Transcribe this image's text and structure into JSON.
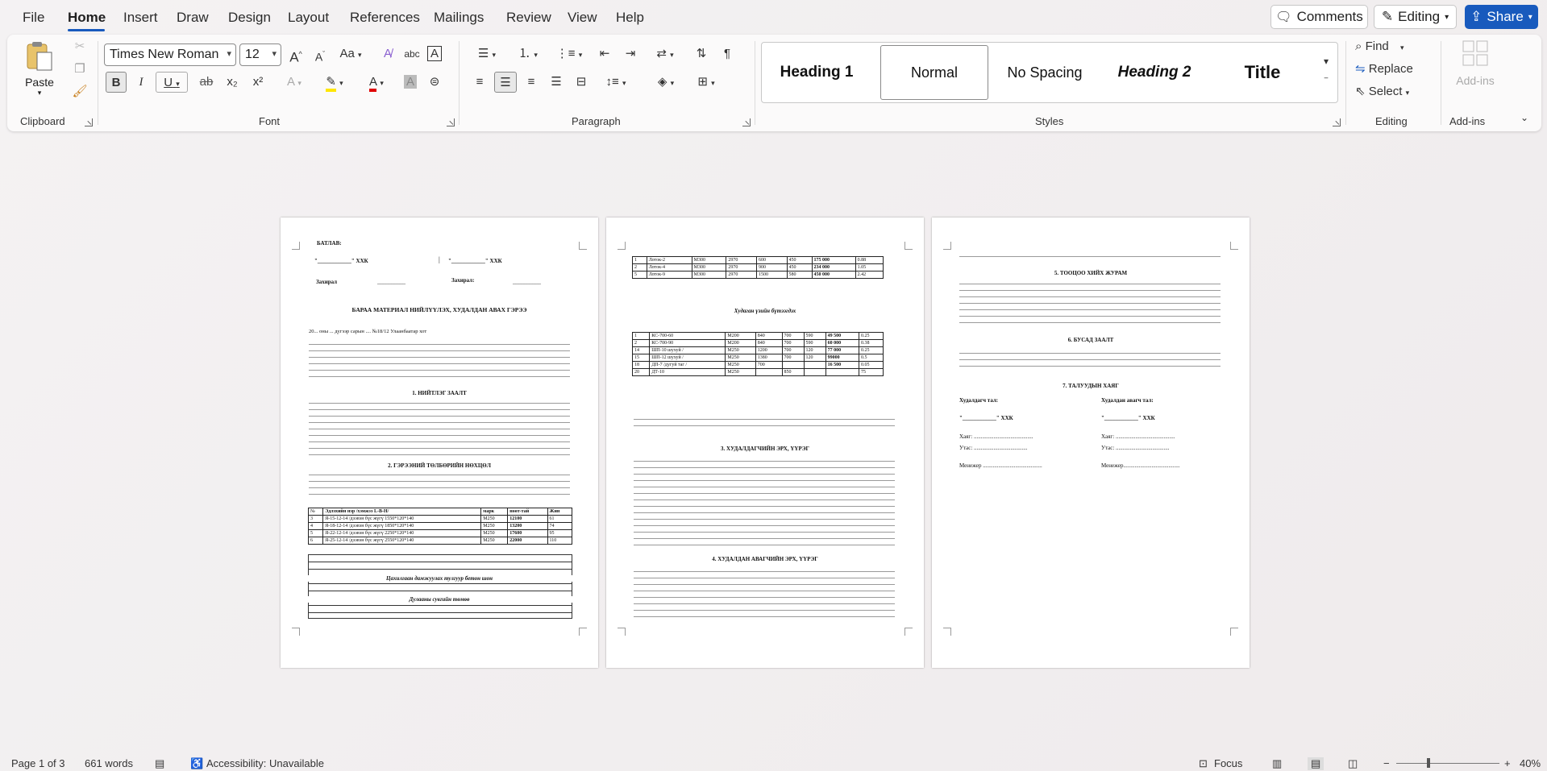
{
  "menu": {
    "items": [
      "File",
      "Home",
      "Insert",
      "Draw",
      "Design",
      "Layout",
      "References",
      "Mailings",
      "Review",
      "View",
      "Help"
    ],
    "comments": "Comments",
    "editing": "Editing",
    "share": "Share"
  },
  "ribbon": {
    "clipboard": {
      "paste": "Paste",
      "label": "Clipboard"
    },
    "font": {
      "name": "Times New Roman",
      "size": "12",
      "label": "Font",
      "grow": "A",
      "shrink": "A",
      "case": "Aa",
      "bold": "B",
      "italic": "I",
      "underline": "U",
      "strike": "ab",
      "sub": "x₂",
      "sup": "x²"
    },
    "paragraph": {
      "label": "Paragraph",
      "pilcrow": "¶"
    },
    "styles": {
      "label": "Styles",
      "items": [
        "Heading 1",
        "Normal",
        "No Spacing",
        "Heading 2",
        "Title"
      ],
      "selected": "Normal"
    },
    "editing": {
      "label": "Editing",
      "find": "Find",
      "replace": "Replace",
      "select": "Select"
    },
    "addins": {
      "label": "Add-ins",
      "button": "Add-ins"
    }
  },
  "pages": {
    "p1": {
      "approve": "БАТЛАВ:",
      "xxk1": "\"____________\" ХХК",
      "xxk2": "\"____________\" ХХК",
      "director1": "Захирал",
      "director2": "Захирал:",
      "title": "БАРАА МАТЕРИАЛ НИЙЛҮҮЛЭХ, ХУДАЛДАН АВАХ ГЭРЭЭ",
      "dateline": "20... оны ... дугээр сарын ....                №18/12                    Улаанбаатар хот",
      "sec1": "1.   НИЙТЛЭГ ЗААЛТ",
      "sec2": "2.   ГЭРЭЭНИЙ ТӨЛБӨРИЙН НӨХЦӨЛ",
      "tbl_head": [
        "№",
        "Эдлэхийн нэр /хэмжээ L-B-H/",
        "марк",
        "нөөт-тай",
        "Жин"
      ],
      "tbl_rows": [
        [
          "3",
          "Я-15-12-14 /дээвэн бүс жүгү 1550*120*140",
          "M250",
          "12100",
          "61"
        ],
        [
          "4",
          "Я-18-12-14 /дээвэн бүс жүгү 1850*120*140",
          "M250",
          "13200",
          "74"
        ],
        [
          "5",
          "Я-22-12-14 /дээвэн бүс жүгү 2250*120*140",
          "M250",
          "17600",
          "95"
        ],
        [
          "6",
          "Я-25-12-14 /дээвэн бүс жүгү 2550*120*140",
          "M250",
          "22000",
          "110"
        ]
      ],
      "tbl2_caption": "Цахилгаан дамжуулах тулгуур бетон шон",
      "tbl3_caption": "Дулааны сувгийн төмөө"
    },
    "p2": {
      "caption": "Худаган үзийн бүтээгдэх",
      "sec3": "3.   ХУДАЛДАГЧИЙН ЭРХ, ҮҮРЭГ",
      "sec4": "4.   ХУДАЛДАН АВАГЧИЙН ЭРХ, ҮҮРЭГ",
      "rows": [
        [
          "1",
          "Лоток-2",
          "M300",
          "2970",
          "600",
          "450",
          "175 000",
          "0.88"
        ],
        [
          "2",
          "Лоток-4",
          "M300",
          "2970",
          "900",
          "450",
          "234 000",
          "1.05"
        ],
        [
          "5",
          "Лоток-9",
          "M300",
          "2970",
          "1500",
          "580",
          "450 000",
          "2.42"
        ]
      ],
      "rows2": [
        [
          "1",
          "КС-700-60",
          "M200",
          "840",
          "700",
          "590",
          "49 500",
          "0.25"
        ],
        [
          "2",
          "КС-700-90",
          "M200",
          "840",
          "700",
          "590",
          "60 000",
          "0.38"
        ],
        [
          "14",
          "ШП-10 шухуй /",
          "M250",
          "1200",
          "700",
          "120",
          "77 000",
          "0.25"
        ],
        [
          "15",
          "ШП-12 шухуй /",
          "M250",
          "1380",
          "700",
          "120",
          "99000",
          "0.5"
        ],
        [
          "18",
          "ДП-7 /дугуй таг /",
          "M250",
          "700",
          "",
          "",
          "16 500",
          "0.05"
        ],
        [
          "20",
          "ДТ-10",
          "M250",
          "",
          "850",
          "",
          "",
          "75"
        ]
      ]
    },
    "p3": {
      "sec5": "5.   ТООЦОО ХИЙХ ЖУРАМ",
      "sec6": "6.   БУСАД ЗААЛТ",
      "sec7": "7. ТАЛУУДЫН ХАЯГ",
      "seller": "Худалдагч тал:",
      "buyer": "Худалдан авагч тал:",
      "xxk1": "\"____________\" ХХК",
      "xxk2": "\"____________\" ХХК",
      "addr": "Хаяг: ..........................................",
      "phone": "Утас: ......................................",
      "manager": "Менежер ..........................................",
      "manager2": "Менежер........................................"
    }
  },
  "status": {
    "page": "Page 1 of 3",
    "words": "661 words",
    "accessibility": "Accessibility: Unavailable",
    "focus": "Focus",
    "zoom": "40%"
  }
}
